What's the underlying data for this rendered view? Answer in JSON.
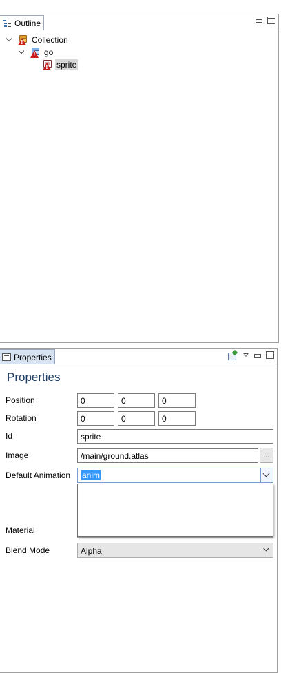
{
  "outline": {
    "tab_label": "Outline",
    "tree": [
      {
        "label": "Collection",
        "depth": 0,
        "expanded": true,
        "icon": "collection-icon"
      },
      {
        "label": "go",
        "depth": 1,
        "expanded": true,
        "icon": "game-object-icon"
      },
      {
        "label": "sprite",
        "depth": 2,
        "expanded": false,
        "icon": "sprite-icon",
        "selected": true
      }
    ]
  },
  "properties": {
    "tab_label": "Properties",
    "title": "Properties",
    "position_label": "Position",
    "position": {
      "x": "0",
      "y": "0",
      "z": "0"
    },
    "rotation_label": "Rotation",
    "rotation": {
      "x": "0",
      "y": "0",
      "z": "0"
    },
    "id_label": "Id",
    "id_value": "sprite",
    "image_label": "Image",
    "image_value": "/main/ground.atlas",
    "browse_label": "...",
    "default_animation_label": "Default Animation",
    "default_animation_value": "anim",
    "material_label": "Material",
    "blend_mode_label": "Blend Mode",
    "blend_mode_value": "Alpha"
  },
  "colors": {
    "accent": "#3399ff",
    "title": "#1f3d66",
    "warning": "#c81e1e"
  }
}
